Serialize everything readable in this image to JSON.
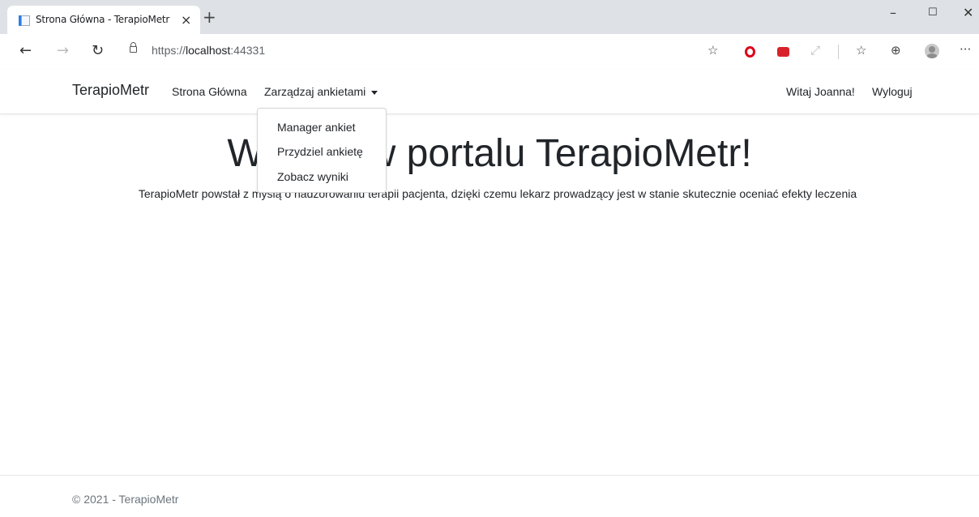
{
  "browser": {
    "tab_title": "Strona Główna - TerapioMetr",
    "tab_close": "×",
    "new_tab": "+",
    "window_min": "–",
    "window_max": "☐",
    "window_close": "✕",
    "url_scheme": "https://",
    "url_host": "localhost",
    "url_port": ":44331",
    "icons": [
      "back-icon",
      "forward-icon",
      "refresh-icon",
      "lock-icon",
      "favorites-add-icon",
      "opera-icon",
      "extension-icon",
      "cast-icon",
      "favorites-icon",
      "collections-icon",
      "profile-icon",
      "more-icon"
    ]
  },
  "navbar": {
    "brand": "TerapioMetr",
    "links": [
      {
        "label": "Strona Główna"
      },
      {
        "label": "Zarządzaj ankietami"
      }
    ],
    "greeting": "Witaj Joanna!",
    "logout": "Wyloguj"
  },
  "dropdown": {
    "items": [
      {
        "label": "Manager ankiet"
      },
      {
        "label": "Przydziel ankietę"
      },
      {
        "label": "Zobacz wyniki"
      }
    ]
  },
  "main": {
    "heading": "Witamy w portalu TerapioMetr!",
    "lead": "TerapioMetr powstał z myślą o nadzorowaniu terapii pacjenta, dzięki czemu lekarz prowadzący jest w stanie skutecznie oceniać efekty leczenia"
  },
  "footer": {
    "text": "© 2021 - TerapioMetr"
  }
}
